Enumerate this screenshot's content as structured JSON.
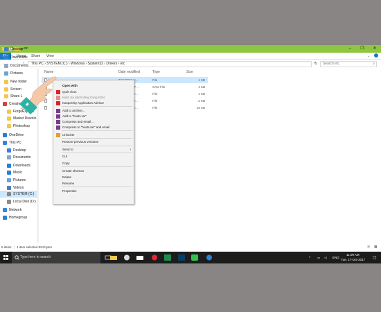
{
  "colors": {
    "title_bar": "#8dc63f",
    "file_tab": "#1979ca",
    "selection": "#cce8ff",
    "taskbar": "#1c1c1c",
    "background": "#888584"
  },
  "window": {
    "title": "etc",
    "controls": [
      "–",
      "❐",
      "✕"
    ]
  },
  "ribbon": {
    "tabs": [
      "File",
      "Home",
      "Share",
      "View"
    ]
  },
  "address": {
    "path": "This PC  ›  SYSTEM (C:)  ›  Windows  ›  System32  ›  Drivers  ›  etc",
    "search_placeholder": "Search etc"
  },
  "nav": {
    "items": [
      {
        "label": "Desktop",
        "icon": "desktop-icon"
      },
      {
        "label": "Downloads",
        "icon": "downloads-icon"
      },
      {
        "label": "Documents",
        "icon": "documents-icon"
      },
      {
        "label": "Pictures",
        "icon": "pictures-icon"
      },
      {
        "label": "New folder",
        "icon": "folder-icon"
      },
      {
        "label": "Screen",
        "icon": "folder-icon"
      },
      {
        "label": "Share L",
        "icon": "folder-icon"
      },
      {
        "label": "Creative Cloud Fi",
        "icon": "creative-cloud-icon"
      },
      {
        "label": "ForgeExports",
        "icon": "folder-icon"
      },
      {
        "label": "Market Downlo",
        "icon": "folder-icon"
      },
      {
        "label": "Photoshop",
        "icon": "folder-icon"
      },
      {
        "label": "OneDrive",
        "icon": "onedrive-icon"
      },
      {
        "label": "This PC",
        "icon": "pc-icon"
      },
      {
        "label": "Desktop",
        "icon": "desktop-icon"
      },
      {
        "label": "Documents",
        "icon": "documents-icon"
      },
      {
        "label": "Downloads",
        "icon": "downloads-icon"
      },
      {
        "label": "Music",
        "icon": "music-icon"
      },
      {
        "label": "Pictures",
        "icon": "pictures-icon"
      },
      {
        "label": "Videos",
        "icon": "videos-icon"
      },
      {
        "label": "SYSTEM (C:)",
        "icon": "drive-icon"
      },
      {
        "label": "Local Disk (D:)",
        "icon": "drive-icon"
      },
      {
        "label": "Network",
        "icon": "network-icon"
      },
      {
        "label": "Homegroup",
        "icon": "homegroup-icon"
      }
    ]
  },
  "files": {
    "headers": {
      "name": "Name",
      "date": "Date modified",
      "type": "Type",
      "size": "Size"
    },
    "rows": [
      {
        "name": "hosts",
        "date": "7/16/2015 2:...",
        "type": "File",
        "size": "1 KB"
      },
      {
        "name": "",
        "date": "17-Oct-2017 ...",
        "type": "SAM File",
        "size": "4 KB"
      },
      {
        "name": "",
        "date": "7/10/2015 2:...",
        "type": "File",
        "size": "1 KB"
      },
      {
        "name": "",
        "date": "7/10/2015 2:...",
        "type": "File",
        "size": "2 KB"
      },
      {
        "name": "",
        "date": "7/10/2015 2:...",
        "type": "File",
        "size": "18 KB"
      }
    ]
  },
  "context_menu": {
    "items": [
      {
        "label": "Open with",
        "kind": "bold"
      },
      {
        "label": "Quét virus",
        "kind": "normal",
        "icon": "kaspersky-icon"
      },
      {
        "label": "Kiểm tra danh tiếng trong KSN",
        "kind": "disabled",
        "icon": "kaspersky-icon"
      },
      {
        "label": "Kaspersky Application Advisor",
        "kind": "normal",
        "icon": "kaspersky-icon"
      },
      {
        "label": "Add to archive...",
        "kind": "normal",
        "icon": "winrar-icon"
      },
      {
        "label": "Add to \"hosts.rar\"",
        "kind": "normal",
        "icon": "winrar-icon"
      },
      {
        "label": "Compress and email...",
        "kind": "normal",
        "icon": "winrar-icon"
      },
      {
        "label": "Compress to \"hosts.rar\" and email",
        "kind": "normal",
        "icon": "winrar-icon"
      },
      {
        "label": "Unlocker",
        "kind": "normal",
        "icon": "unlocker-icon"
      },
      {
        "label": "Restore previous versions",
        "kind": "normal"
      },
      {
        "label": "Send to",
        "kind": "submenu"
      },
      {
        "label": "Cut",
        "kind": "normal"
      },
      {
        "label": "Copy",
        "kind": "normal"
      },
      {
        "label": "Create shortcut",
        "kind": "normal"
      },
      {
        "label": "Delete",
        "kind": "normal"
      },
      {
        "label": "Rename",
        "kind": "normal"
      },
      {
        "label": "Properties",
        "kind": "normal"
      }
    ]
  },
  "status": {
    "item_count": "5 items",
    "selection": "1 item selected  824 bytes"
  },
  "taskbar": {
    "search_text": "Type here to search",
    "language": "ENG",
    "time": "11:09 AM",
    "date": "Tue, 17-Oct-2017"
  }
}
